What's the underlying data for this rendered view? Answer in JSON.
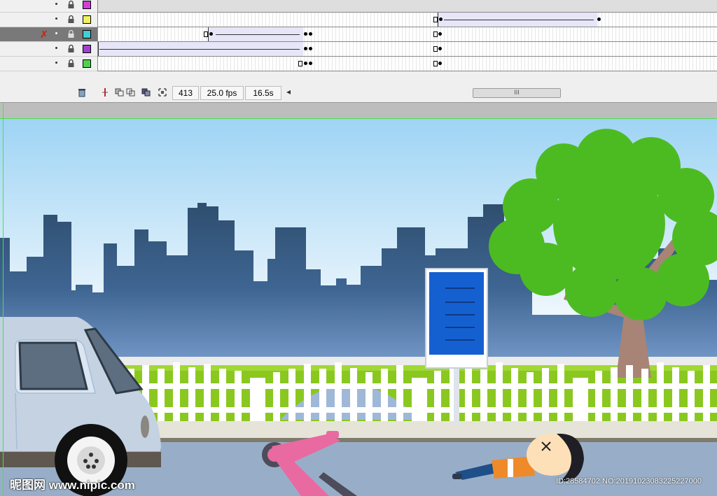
{
  "timeline": {
    "layers": [
      {
        "swatch_color": "#d040d8",
        "selected": false
      },
      {
        "swatch_color": "#f0f060",
        "selected": false
      },
      {
        "swatch_color": "#40d0d8",
        "selected": true
      },
      {
        "swatch_color": "#a040d0",
        "selected": false
      },
      {
        "swatch_color": "#50d050",
        "selected": false
      }
    ],
    "current_frame": "413",
    "fps": "25.0 fps",
    "elapsed": "16.5s",
    "scroll_left_arrow": "◂",
    "scroll_thumb": "III"
  },
  "icons": {
    "delete_layer": "trash-icon",
    "center_frame": "center-frame-icon",
    "onion_skin": "onion-skin-icon",
    "onion_outline": "onion-outline-icon",
    "edit_multiple": "edit-multiple-frames-icon",
    "onion_markers": "onion-markers-icon"
  },
  "watermark": {
    "logo": "昵图网 www.nipic.com",
    "id_text": "ID:28584702 NO:20191023083225227000"
  },
  "colors": {
    "sky_top": "#9ed4f4",
    "sky_bottom": "#f4f9fd",
    "city": "#2f4e6e",
    "grass": "#8ac820",
    "road": "#98aec8",
    "tree": "#4cbb22",
    "sign": "#1560d0"
  }
}
